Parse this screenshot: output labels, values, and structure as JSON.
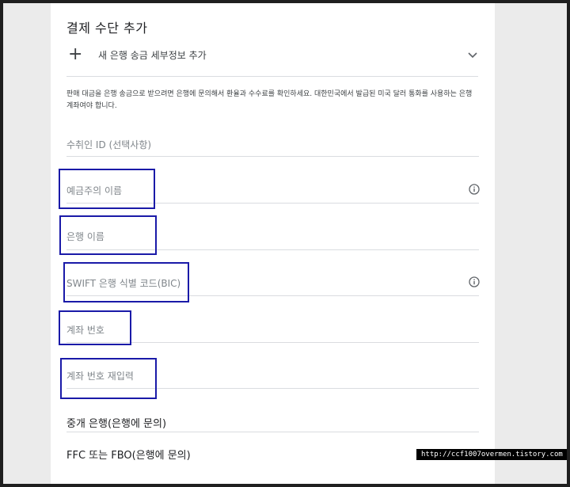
{
  "header": {
    "title": "결제 수단 추가"
  },
  "add_bank": {
    "label": "새 은행 송금 세부정보 추가",
    "icon": "plus-icon",
    "expand_icon": "chevron-down-icon"
  },
  "note": "판매 대금을 은행 송금으로 받으려면 은행에 문의해서 환율과 수수료를 확인하세요. 대한민국에서 발급된 미국 달러 통화를 사용하는 은행 계좌여야 합니다.",
  "fields": {
    "recipient_id": "수취인 ID (선택사항)",
    "account_holder": "예금주의 이름",
    "bank_name": "은행 이름",
    "swift": "SWIFT 은행 식별 코드(BIC)",
    "account_number": "계좌 번호",
    "account_number_confirm": "계좌 번호 재입력"
  },
  "sections": {
    "intermediary": "중개 은행(은행에 문의)",
    "ffc": "FFC 또는 FBO(은행에 문의)"
  },
  "watermark": "http://ccf1007overmen.tistory.com",
  "colors": {
    "highlight": "#1a1aa8",
    "divider": "#dadce0",
    "label": "#80868b"
  }
}
